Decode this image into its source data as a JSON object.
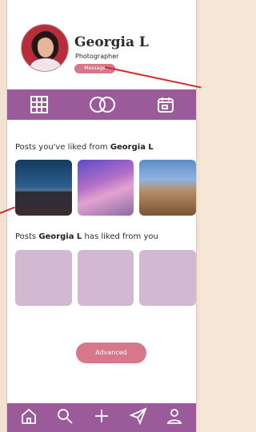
{
  "profile": {
    "name": "Georgia L",
    "role": "Photographer",
    "message_button": "Message"
  },
  "tabs": [
    {
      "name": "grid-tab",
      "icon": "grid-icon"
    },
    {
      "name": "rings-tab",
      "icon": "overlapping-circles-icon"
    },
    {
      "name": "calendar-tab",
      "icon": "calendar-icon"
    }
  ],
  "sections": {
    "liked_from_prefix": "Posts you've liked from ",
    "liked_from_name": "Georgia L",
    "has_liked_prefix": "Posts ",
    "has_liked_name": "Georgia L",
    "has_liked_suffix": " has liked from you"
  },
  "advanced_button": "Advanced",
  "bottom_nav": [
    {
      "name": "home-icon"
    },
    {
      "name": "search-icon"
    },
    {
      "name": "add-icon"
    },
    {
      "name": "send-icon"
    },
    {
      "name": "profile-icon"
    }
  ],
  "colors": {
    "accent": "#9b5a9a",
    "button": "#d6778a",
    "placeholder": "#d2b8d1"
  }
}
